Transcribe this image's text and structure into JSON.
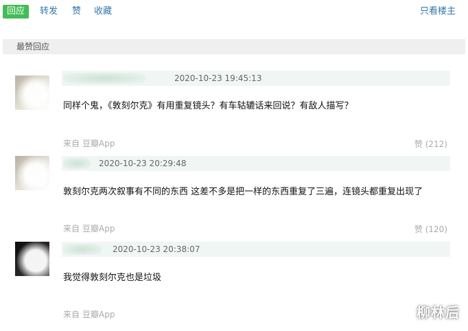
{
  "topbar": {
    "reply": "回应",
    "forward": "转发",
    "like": "赞",
    "collect": "收藏",
    "only_op": "只看楼主"
  },
  "section": {
    "title": "最赞回应"
  },
  "comments": [
    {
      "time": "2020-10-23 19:45:13",
      "text": "同样个鬼，《敦刻尔克》有用重复镜头？有车轱辘话来回说？有敌人描写？",
      "source_prefix": "来自",
      "source_app": "豆瓣App",
      "vote": "赞 (212)"
    },
    {
      "time": "2020-10-23 20:29:48",
      "text": "敦刻尔克两次叙事有不同的东西 这差不多是把一样的东西重复了三遍，连镜头都重复出现了",
      "source_prefix": "来自",
      "source_app": "豆瓣App",
      "vote": "赞 (120)"
    },
    {
      "time": "2020-10-23 20:38:07",
      "text": "我觉得敦刻尔克也是垃圾",
      "source_prefix": "来自",
      "source_app": "豆瓣App",
      "vote": ""
    }
  ],
  "watermark": "柳林后"
}
